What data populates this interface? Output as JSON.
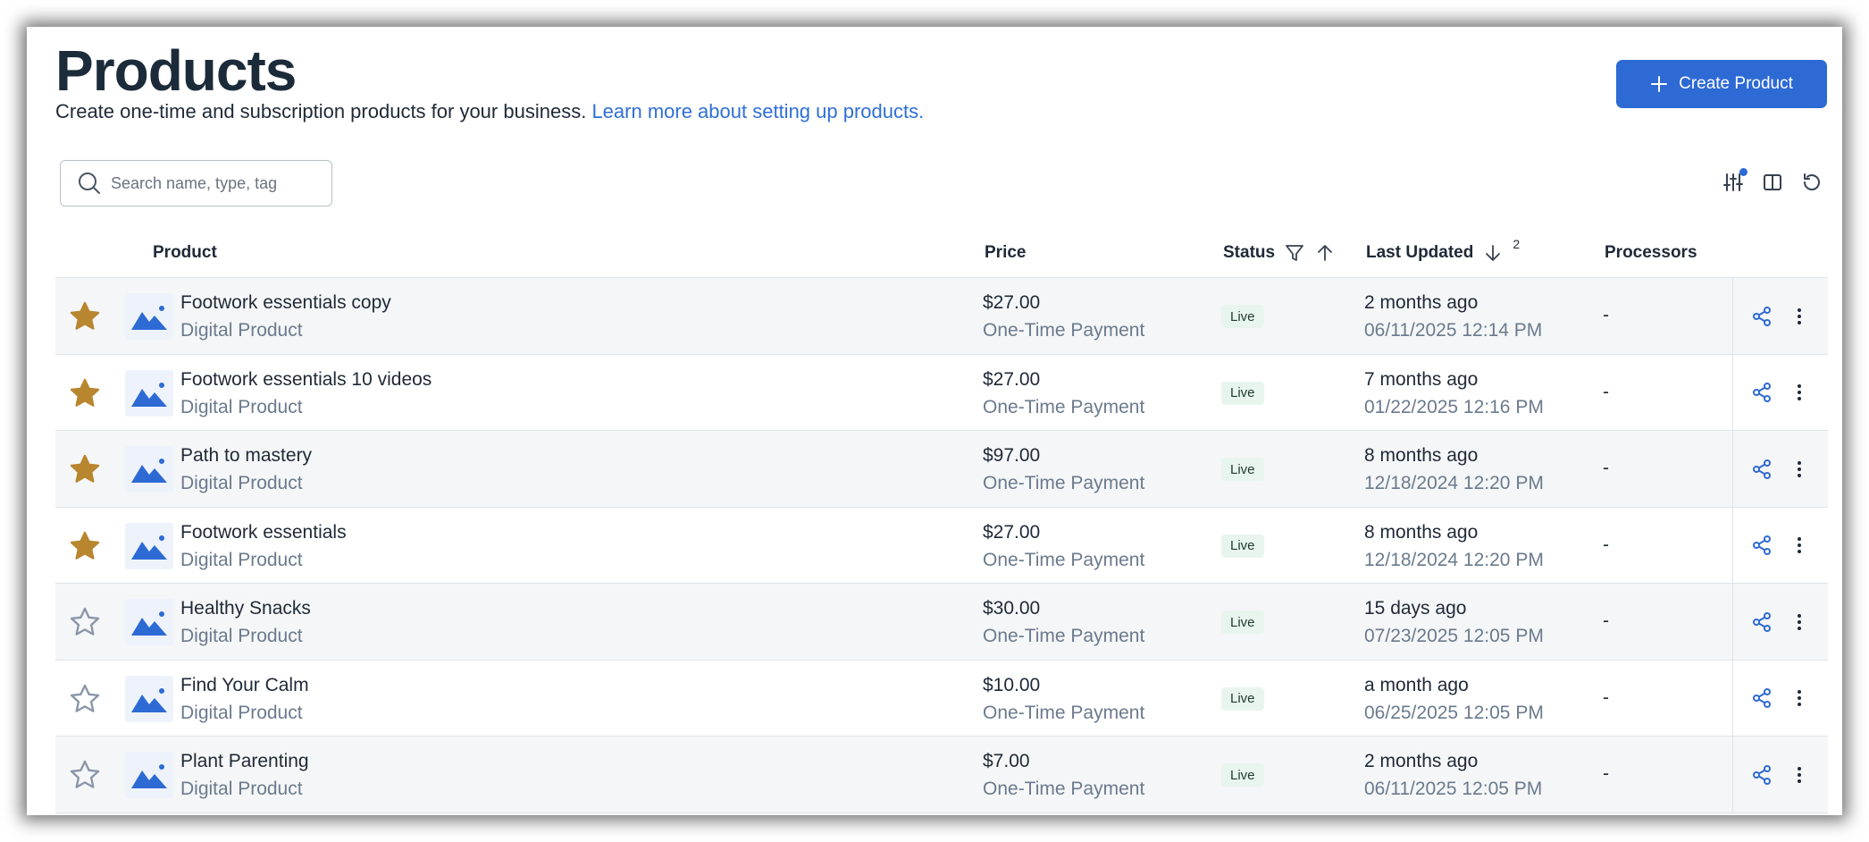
{
  "header": {
    "title": "Products",
    "subtitle": "Create one-time and subscription products for your business.",
    "learn_more": "Learn more about setting up products.",
    "create_label": "Create Product"
  },
  "search": {
    "placeholder": "Search name, type, tag"
  },
  "columns": {
    "product": "Product",
    "price": "Price",
    "status": "Status",
    "last_updated": "Last Updated",
    "last_updated_sort_index": "2",
    "processors": "Processors"
  },
  "colors": {
    "accent": "#2d6ad4",
    "star_filled": "#b8862f",
    "live_badge_bg": "#e8f5ee"
  },
  "rows": [
    {
      "starred": true,
      "name": "Footwork essentials copy",
      "type": "Digital Product",
      "price": "$27.00",
      "payment": "One-Time Payment",
      "status": "Live",
      "updated_rel": "2 months ago",
      "updated_abs": "06/11/2025 12:14 PM",
      "processors": "-"
    },
    {
      "starred": true,
      "name": "Footwork essentials 10 videos",
      "type": "Digital Product",
      "price": "$27.00",
      "payment": "One-Time Payment",
      "status": "Live",
      "updated_rel": "7 months ago",
      "updated_abs": "01/22/2025 12:16 PM",
      "processors": "-"
    },
    {
      "starred": true,
      "name": "Path to mastery",
      "type": "Digital Product",
      "price": "$97.00",
      "payment": "One-Time Payment",
      "status": "Live",
      "updated_rel": "8 months ago",
      "updated_abs": "12/18/2024 12:20 PM",
      "processors": "-"
    },
    {
      "starred": true,
      "name": "Footwork essentials",
      "type": "Digital Product",
      "price": "$27.00",
      "payment": "One-Time Payment",
      "status": "Live",
      "updated_rel": "8 months ago",
      "updated_abs": "12/18/2024 12:20 PM",
      "processors": "-"
    },
    {
      "starred": false,
      "name": "Healthy Snacks",
      "type": "Digital Product",
      "price": "$30.00",
      "payment": "One-Time Payment",
      "status": "Live",
      "updated_rel": "15 days ago",
      "updated_abs": "07/23/2025 12:05 PM",
      "processors": "-"
    },
    {
      "starred": false,
      "name": "Find Your Calm",
      "type": "Digital Product",
      "price": "$10.00",
      "payment": "One-Time Payment",
      "status": "Live",
      "updated_rel": "a month ago",
      "updated_abs": "06/25/2025 12:05 PM",
      "processors": "-"
    },
    {
      "starred": false,
      "name": "Plant Parenting",
      "type": "Digital Product",
      "price": "$7.00",
      "payment": "One-Time Payment",
      "status": "Live",
      "updated_rel": "2 months ago",
      "updated_abs": "06/11/2025 12:05 PM",
      "processors": "-"
    }
  ]
}
